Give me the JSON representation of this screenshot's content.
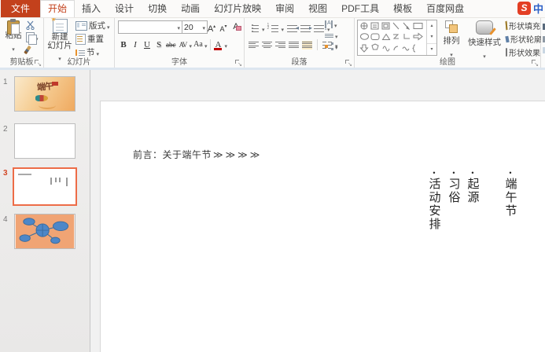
{
  "window": {
    "tabs": [
      "文件",
      "开始",
      "插入",
      "设计",
      "切换",
      "动画",
      "幻灯片放映",
      "审阅",
      "视图",
      "PDF工具",
      "模板",
      "百度网盘"
    ],
    "active_tab": "开始",
    "ime": {
      "logo_letter": "S",
      "mode_label": "中"
    }
  },
  "ribbon": {
    "clipboard": {
      "label": "剪贴板",
      "paste": "粘贴"
    },
    "slides": {
      "label": "幻灯片",
      "new_slide_line1": "新建",
      "new_slide_line2": "幻灯片",
      "layout": "版式",
      "reset": "重置",
      "section": "节"
    },
    "font": {
      "label": "字体",
      "font_name_value": "",
      "size_value": "20",
      "bold": "B",
      "italic": "I",
      "underline": "U",
      "shadow": "S",
      "strikethrough": "abc",
      "char_spacing": "AV",
      "change_case": "Aa",
      "font_color": "A"
    },
    "paragraph": {
      "label": "段落"
    },
    "drawing": {
      "label": "绘图",
      "arrange": "排列",
      "quick_styles": "快速样式",
      "shape_fill": "形状填充",
      "shape_outline": "形状轮廓",
      "shape_effects": "形状效果"
    }
  },
  "sidebar": {
    "slides": [
      {
        "number": "1",
        "title_text": "端午"
      },
      {
        "number": "2"
      },
      {
        "number": "3",
        "selected": true
      },
      {
        "number": "4"
      }
    ]
  },
  "slide": {
    "intro_text": "前言：关于端午节",
    "intro_chevrons": "≫≫≫≫",
    "bullet_char": "•",
    "toc_columns": [
      {
        "text": "端午节"
      },
      {
        "text": "起源"
      },
      {
        "text": "习俗"
      },
      {
        "text": "活动安排"
      }
    ]
  },
  "colors": {
    "file_tab_red": "#C3411C",
    "active_tab_text": "#C3411C",
    "selection_border": "#ED6C47",
    "diagram_blue": "#4D87C8",
    "thumb_salmon": "#F0A474",
    "ime_logo_red": "#E33E24"
  }
}
